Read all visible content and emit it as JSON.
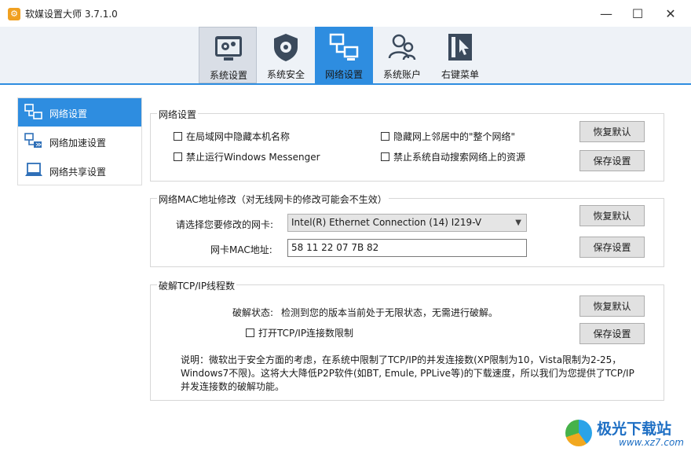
{
  "window": {
    "title": "软媒设置大师 3.7.1.0",
    "minimize": "—",
    "maximize": "☐",
    "close": "✕"
  },
  "toolbar": {
    "tabs": [
      {
        "label": "系统设置",
        "icon": "gear-window-icon",
        "state": "hover"
      },
      {
        "label": "系统安全",
        "icon": "shield-gear-icon",
        "state": "normal"
      },
      {
        "label": "网络设置",
        "icon": "network-icon",
        "state": "active"
      },
      {
        "label": "系统账户",
        "icon": "users-icon",
        "state": "normal"
      },
      {
        "label": "右键菜单",
        "icon": "cursor-menu-icon",
        "state": "normal"
      }
    ],
    "accent": "#2e8de0"
  },
  "nav": {
    "items": [
      {
        "label": "网络设置",
        "icon": "network-settings-icon",
        "active": true
      },
      {
        "label": "网络加速设置",
        "icon": "network-speed-icon",
        "active": false
      },
      {
        "label": "网络共享设置",
        "icon": "laptop-share-icon",
        "active": false
      }
    ]
  },
  "network": {
    "title": "网络设置",
    "options": [
      {
        "label": "在局域网中隐藏本机名称",
        "checked": false
      },
      {
        "label": "隐藏网上邻居中的\"整个网络\"",
        "checked": false
      },
      {
        "label": "禁止运行Windows Messenger",
        "checked": false
      },
      {
        "label": "禁止系统自动搜索网络上的资源",
        "checked": false
      }
    ],
    "restore_label": "恢复默认",
    "save_label": "保存设置"
  },
  "mac": {
    "title": "网络MAC地址修改（对无线网卡的修改可能会不生效）",
    "adapter_label": "请选择您要修改的网卡:",
    "adapter_value": "Intel(R) Ethernet Connection (14) I219-V",
    "address_label": "网卡MAC地址:",
    "address_value": "58 11 22 07 7B 82",
    "restore_label": "恢复默认",
    "save_label": "保存设置"
  },
  "tcpip": {
    "title": "破解TCP/IP线程数",
    "status_label": "破解状态:",
    "status_text": "检测到您的版本当前处于无限状态，无需进行破解。",
    "toggle_label": "打开TCP/IP连接数限制",
    "description": "说明：微软出于安全方面的考虑，在系统中限制了TCP/IP的并发连接数(XP限制为10，Vista限制为2-25，Windows7不限)。这将大大降低P2P软件(如BT, Emule, PPLive等)的下载速度，所以我们为您提供了TCP/IP并发连接数的破解功能。",
    "restore_label": "恢复默认",
    "save_label": "保存设置"
  },
  "watermark": {
    "brand": "极光下载站",
    "url": "www.xz7.com"
  }
}
